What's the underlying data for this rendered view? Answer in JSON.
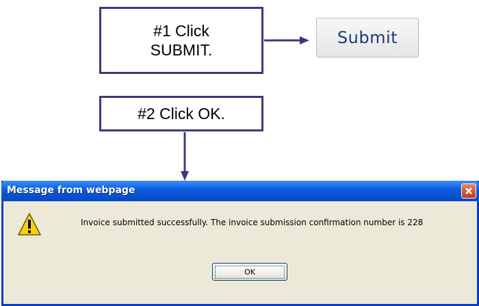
{
  "callouts": {
    "step1_line1": "#1 Click",
    "step1_line2": "SUBMIT.",
    "step2": "#2 Click OK."
  },
  "submit_button": {
    "label": "Submit"
  },
  "dialog": {
    "title": "Message from webpage",
    "message": "Invoice submitted successfully. The invoice submission confirmation number is 228",
    "ok_label": "OK",
    "icon": "warning-icon",
    "close_icon": "close-icon"
  },
  "colors": {
    "callout_border": "#3a3a80",
    "arrow": "#3a3a80",
    "titlebar": "#0a5bdc",
    "dialog_bg": "#ece9d8",
    "close_btn": "#c0391b"
  }
}
